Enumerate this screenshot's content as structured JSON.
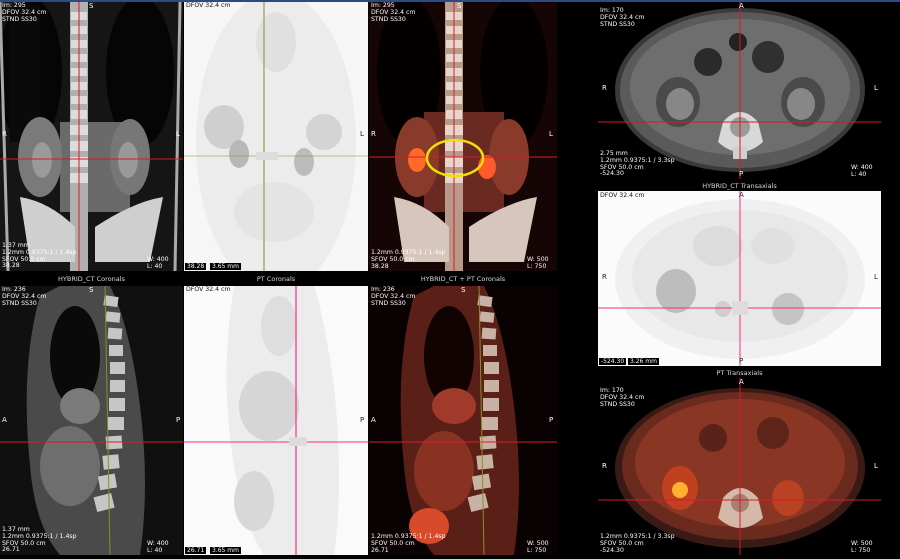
{
  "colors": {
    "background": "#000000",
    "crosshair": "#d81a2a",
    "pt_crosshair": "#ff2a8a",
    "pt_crosshair_olive": "#8b8b2a",
    "roi_ellipse": "#f0e000",
    "window_border": "#2a4a8a"
  },
  "panel_titles": {
    "hybrid_ct_coronals": "HYBRID_CT Coronals",
    "pt_coronals": "PT Coronals",
    "fused_coronals": "HYBRID_CT + PT Coronals",
    "hybrid_ct_transaxials": "HYBRID_CT Transaxials",
    "pt_transaxials": "PT Transaxials"
  },
  "ct_cor_top": {
    "info": "Im: 295\nDFOV 32.4 cm\nSTND SS30",
    "bottom": "1.37 mm\n1.2mm 0.9375:1 / 1.4sp\nSFOV 50.0 cm\n38.28",
    "wl": "W: 400\nL: 40"
  },
  "pt_cor_top": {
    "info": "DFOV 32.4 cm",
    "scale_left": "38.28",
    "scale_right": "3.65 mm"
  },
  "fus_cor_top": {
    "info": "Im: 295\nDFOV 32.4 cm\nSTND SS30",
    "bottom": "1.2mm 0.9375:1 / 1.4sp\nSFOV 50.0 cm\n38.28",
    "wl": "W: 500\nL: 750"
  },
  "ct_ax": {
    "info": "Im: 170\nDFOV 32.4 cm\nSTND SS30",
    "bottom": "2.75 mm\n1.2mm 0.9375:1 / 3.3sp\nSFOV 50.0 cm\n-524.30",
    "wl": "W: 400\nL: 40"
  },
  "pt_ax": {
    "info": "DFOV 32.4 cm",
    "scale_left": "-524.30",
    "scale_right": "3.26 mm"
  },
  "fus_ax": {
    "info": "Im: 170\nDFOV 32.4 cm\nSTND SS30",
    "bottom": "1.2mm 0.9375:1 / 3.3sp\nSFOV 50.0 cm\n-524.30",
    "wl": "W: 500\nL: 750"
  },
  "ct_sag": {
    "info": "Im: 236\nDFOV 32.4 cm\nSTND SS30",
    "bottom": "1.37 mm\n1.2mm 0.9375:1 / 1.4sp\nSFOV 50.0 cm\n26.71",
    "wl": "W: 400\nL: 40"
  },
  "pt_sag": {
    "info": "DFOV 32.4 cm",
    "scale_left": "26.71",
    "scale_right": "3.65 mm"
  },
  "fus_sag": {
    "info": "Im: 236\nDFOV 32.4 cm\nSTND SS30",
    "bottom": "1.2mm 0.9375:1 / 1.4sp\nSFOV 50.0 cm\n26.71",
    "wl": "W: 500\nL: 750"
  },
  "orientation": {
    "R": "R",
    "L": "L",
    "A": "A",
    "P": "P",
    "S": "S",
    "I": "I"
  }
}
